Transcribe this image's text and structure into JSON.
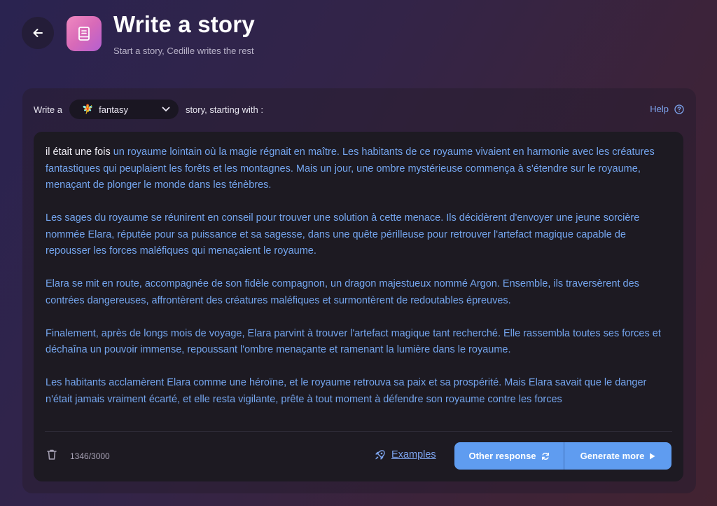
{
  "header": {
    "title": "Write a story",
    "subtitle": "Start a story, Cedille writes the rest",
    "back_icon": "arrow-left-icon",
    "app_icon": "book-icon"
  },
  "prompt": {
    "prefix": "Write a",
    "genre": {
      "emoji": "🧚",
      "label": "fantasy"
    },
    "suffix": "story, starting with :"
  },
  "help": {
    "label": "Help",
    "icon": "question-circle-icon"
  },
  "story": {
    "seed": "il était une fois",
    "paragraphs": [
      " un royaume lointain où la magie régnait en maître. Les habitants de ce royaume vivaient en harmonie avec les créatures fantastiques qui peuplaient les forêts et les montagnes. Mais un jour, une ombre mystérieuse commença à s'étendre sur le royaume, menaçant de plonger le monde dans les ténèbres.",
      "Les sages du royaume se réunirent en conseil pour trouver une solution à cette menace. Ils décidèrent d'envoyer une jeune sorcière nommée Elara, réputée pour sa puissance et sa sagesse, dans une quête périlleuse pour retrouver l'artefact magique capable de repousser les forces maléfiques qui menaçaient le royaume.",
      "Elara se mit en route, accompagnée de son fidèle compagnon, un dragon majestueux nommé Argon. Ensemble, ils traversèrent des contrées dangereuses, affrontèrent des créatures maléfiques et surmontèrent de redoutables épreuves.",
      "Finalement, après de longs mois de voyage, Elara parvint à trouver l'artefact magique tant recherché. Elle rassembla toutes ses forces et déchaîna un pouvoir immense, repoussant l'ombre menaçante et ramenant la lumière dans le royaume.",
      "Les habitants acclamèrent Elara comme une héroïne, et le royaume retrouva sa paix et sa prospérité. Mais Elara savait que le danger n'était jamais vraiment écarté, et elle resta vigilante, prête à tout moment à défendre son royaume contre les forces"
    ]
  },
  "footer": {
    "counter": "1346/3000",
    "examples_label": "Examples",
    "other_response_label": "Other response",
    "generate_more_label": "Generate more"
  },
  "colors": {
    "accent": "#5f9cf0",
    "link": "#7da4ee",
    "generated_text": "#74a5ee",
    "seed_text": "#f2f0f7"
  }
}
